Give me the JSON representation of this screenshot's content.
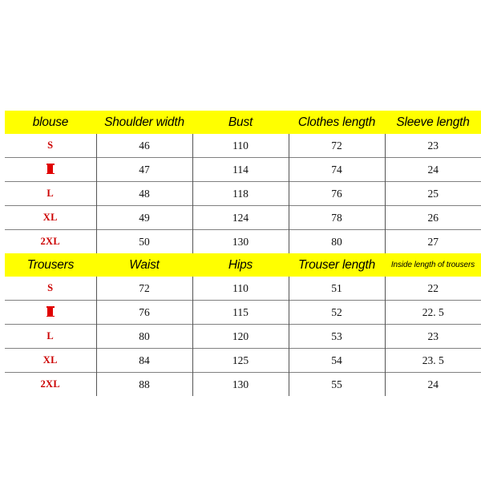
{
  "document": {
    "type": "apparel-size-chart",
    "background_color": "#ffffff",
    "header_background_color": "#ffff00",
    "size_label_color": "#cc0000",
    "grid_line_color": "#808080",
    "unit_note": ""
  },
  "tables": [
    {
      "id": "blouse",
      "headers": [
        "blouse",
        "Shoulder width",
        "Bust",
        "Clothes length",
        "Sleeve length"
      ],
      "rows": [
        {
          "size": "S",
          "size_is_block_glyph": false,
          "values": [
            "46",
            "110",
            "72",
            "23"
          ]
        },
        {
          "size": "M",
          "size_is_block_glyph": true,
          "values": [
            "47",
            "114",
            "74",
            "24"
          ]
        },
        {
          "size": "L",
          "size_is_block_glyph": false,
          "values": [
            "48",
            "118",
            "76",
            "25"
          ]
        },
        {
          "size": "XL",
          "size_is_block_glyph": false,
          "values": [
            "49",
            "124",
            "78",
            "26"
          ]
        },
        {
          "size": "2XL",
          "size_is_block_glyph": false,
          "values": [
            "50",
            "130",
            "80",
            "27"
          ]
        }
      ]
    },
    {
      "id": "trousers",
      "headers": [
        "Trousers",
        "Waist",
        "Hips",
        "Trouser length",
        "Inside length of trousers"
      ],
      "rows": [
        {
          "size": "S",
          "size_is_block_glyph": false,
          "values": [
            "72",
            "110",
            "51",
            "22"
          ]
        },
        {
          "size": "M",
          "size_is_block_glyph": true,
          "values": [
            "76",
            "115",
            "52",
            "22. 5"
          ]
        },
        {
          "size": "L",
          "size_is_block_glyph": false,
          "values": [
            "80",
            "120",
            "53",
            "23"
          ]
        },
        {
          "size": "XL",
          "size_is_block_glyph": false,
          "values": [
            "84",
            "125",
            "54",
            "23. 5"
          ]
        },
        {
          "size": "2XL",
          "size_is_block_glyph": false,
          "values": [
            "88",
            "130",
            "55",
            "24"
          ]
        }
      ]
    }
  ]
}
